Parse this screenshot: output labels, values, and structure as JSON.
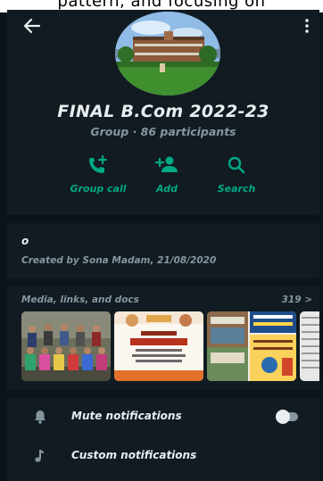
{
  "overlay_text": "pattern, and focusing on",
  "header": {
    "back_icon": "arrow-left-icon",
    "menu_icon": "more-vertical-icon"
  },
  "group": {
    "name": "FINAL B.Com 2022-23",
    "subtitle": "Group · 86 participants"
  },
  "actions": [
    {
      "label": "Group call",
      "icon": "add-call-icon"
    },
    {
      "label": "Add",
      "icon": "add-person-icon"
    },
    {
      "label": "Search",
      "icon": "search-icon"
    }
  ],
  "description": {
    "text": "o",
    "created": "Created by Sona Madam, 21/08/2020"
  },
  "media": {
    "title": "Media, links, and docs",
    "count": "319 >"
  },
  "settings": [
    {
      "label": "Mute notifications",
      "icon": "bell-icon",
      "toggle_on": false
    },
    {
      "label": "Custom notifications",
      "icon": "music-note-icon"
    }
  ],
  "colors": {
    "background": "#111b21",
    "accent": "#00a884",
    "secondary_text": "#8696a0"
  }
}
